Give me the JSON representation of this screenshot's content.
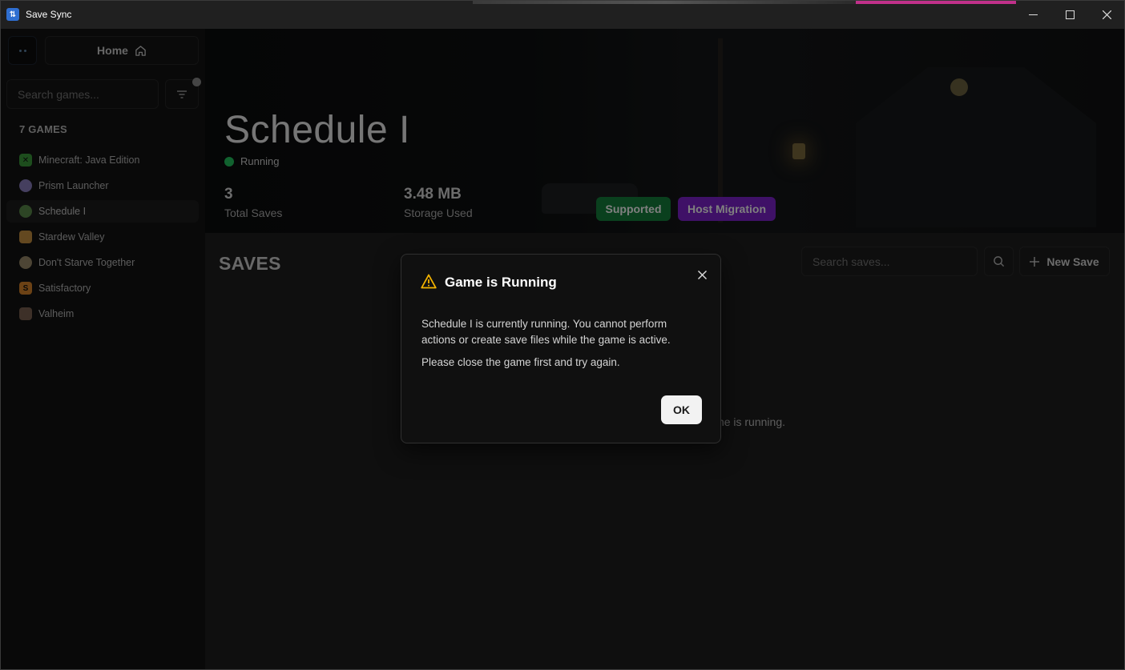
{
  "window": {
    "title": "Save Sync",
    "app_icon": "save-sync-logo-icon"
  },
  "sidebar": {
    "home_label": "Home",
    "search_placeholder": "Search games...",
    "games_count_label": "7 GAMES",
    "games": [
      {
        "name": "Minecraft: Java Edition",
        "icon": "minecraft-icon",
        "color": "#3a9a3a"
      },
      {
        "name": "Prism Launcher",
        "icon": "prism-launcher-icon",
        "color": "#8a7fbf"
      },
      {
        "name": "Schedule I",
        "icon": "schedule-i-icon",
        "color": "#5a8a4a",
        "active": true
      },
      {
        "name": "Stardew Valley",
        "icon": "stardew-valley-icon",
        "color": "#c79040"
      },
      {
        "name": "Don't Starve Together",
        "icon": "dont-starve-together-icon",
        "color": "#9a8a6a"
      },
      {
        "name": "Satisfactory",
        "icon": "satisfactory-icon",
        "color": "#d9842a"
      },
      {
        "name": "Valheim",
        "icon": "valheim-icon",
        "color": "#7a6050"
      }
    ]
  },
  "game": {
    "title": "Schedule I",
    "status": "Running",
    "status_color": "#22c55e",
    "total_saves_value": "3",
    "total_saves_label": "Total Saves",
    "storage_value": "3.48 MB",
    "storage_label": "Storage Used",
    "tags": [
      {
        "label": "Supported",
        "color": "#15803d"
      },
      {
        "label": "Host Migration",
        "color": "#7e22ce"
      }
    ]
  },
  "saves": {
    "title": "SAVES",
    "search_placeholder": "Search saves...",
    "new_save_label": "New Save",
    "empty_message_visible": "ne is running."
  },
  "dialog": {
    "title": "Game is Running",
    "body_line1": "Schedule I is currently running. You cannot perform actions or create save files while the game is active.",
    "body_line2": "Please close the game first and try again.",
    "ok_label": "OK"
  }
}
